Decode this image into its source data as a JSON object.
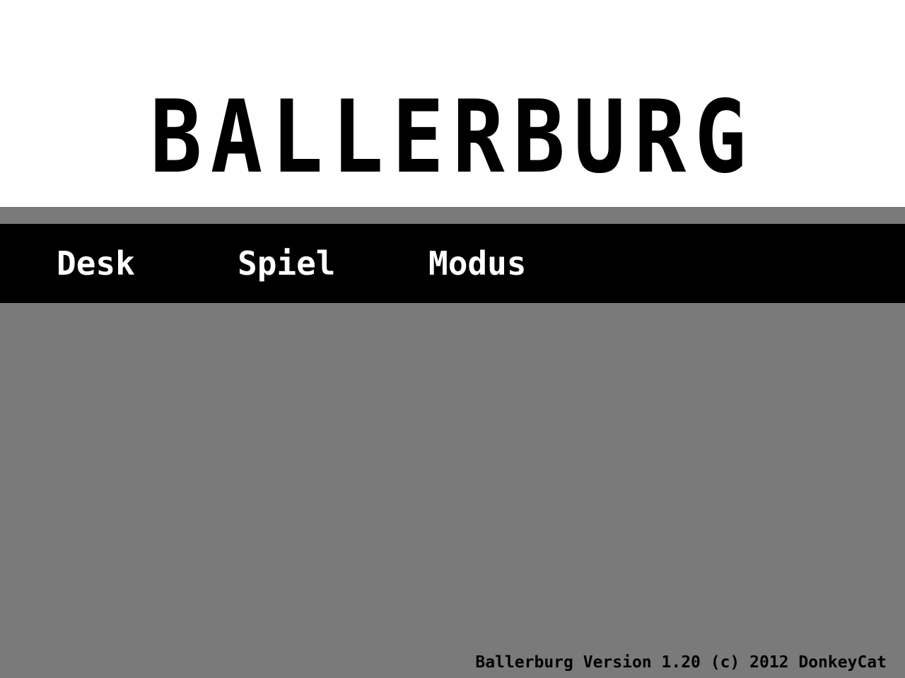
{
  "app": {
    "title": "BALLERBURG"
  },
  "menu": {
    "items": [
      {
        "label": "Desk"
      },
      {
        "label": "Spiel"
      },
      {
        "label": "Modus"
      }
    ]
  },
  "footer": {
    "version_text": "Ballerburg Version 1.20 (c) 2012 DonkeyCat"
  },
  "colors": {
    "title_background": "#ffffff",
    "desktop_background": "#7a7a7a",
    "menubar_background": "#000000",
    "menu_text": "#ffffff",
    "title_text": "#000000"
  }
}
